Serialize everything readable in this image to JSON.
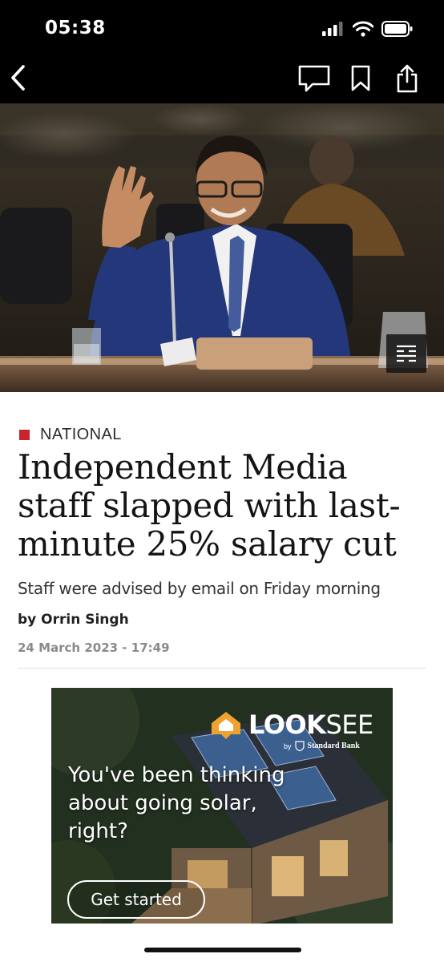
{
  "status_bar": {
    "time": "05:38"
  },
  "nav": {
    "back_icon": "chevron-left-icon",
    "actions": [
      "comment-icon",
      "bookmark-icon",
      "share-icon"
    ]
  },
  "hero": {
    "gallery_icon": "gallery-list-icon"
  },
  "article": {
    "category": "NATIONAL",
    "headline": "Independent Media staff slapped with last-minute 25% salary cut",
    "subtitle": "Staff were advised by email on Friday morning",
    "byline": "by Orrin Singh",
    "date": "24 March 2023 - 17:49"
  },
  "ad": {
    "brand_bold": "LOOK",
    "brand_light": "SEE",
    "by": "by",
    "sponsor": "Standard Bank",
    "headline": "You've been thinking about going solar, right?",
    "cta": "Get started"
  },
  "colors": {
    "accent": "#c9232b",
    "topbar": "#000000"
  }
}
